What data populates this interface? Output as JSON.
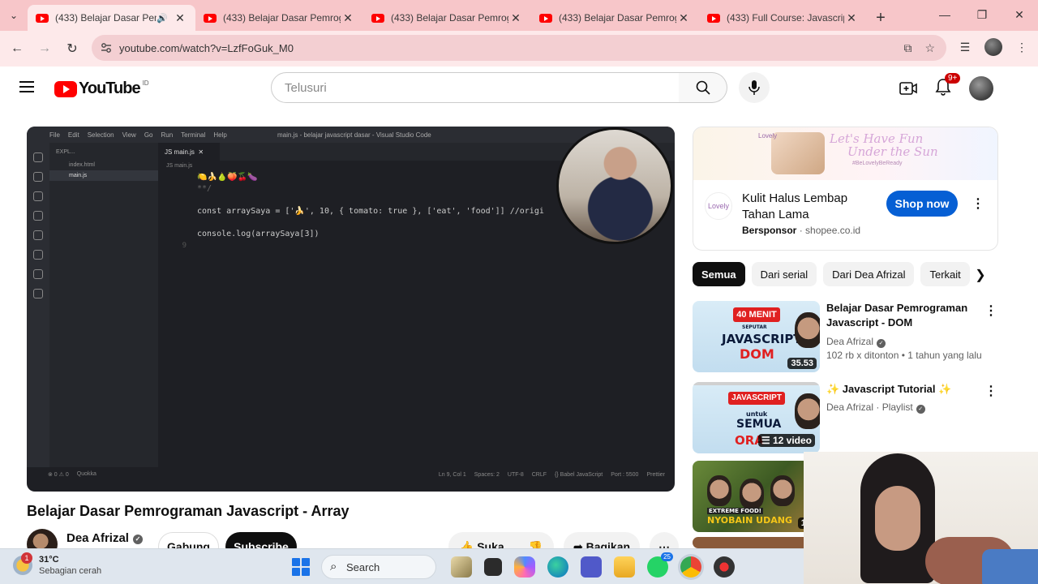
{
  "browser": {
    "tabs": [
      {
        "title": "(433) Belajar Dasar Pemrograman",
        "active": true,
        "audio": true
      },
      {
        "title": "(433) Belajar Dasar Pemrograman",
        "active": false
      },
      {
        "title": "(433) Belajar Dasar Pemrograman",
        "active": false
      },
      {
        "title": "(433) Belajar Dasar Pemrograman",
        "active": false
      },
      {
        "title": "(433) Full Course: Javascript",
        "active": false
      }
    ],
    "url": "youtube.com/watch?v=LzfFoGuk_M0"
  },
  "yt": {
    "logo_word": "YouTube",
    "country": "ID",
    "search_placeholder": "Telusuri",
    "notif_count": "9+"
  },
  "player": {
    "vscode_menu": [
      "File",
      "Edit",
      "Selection",
      "View",
      "Go",
      "Run",
      "Terminal",
      "Help"
    ],
    "window_title": "main.js - belajar javascript dasar - Visual Studio Code",
    "explorer_header": "EXPL...",
    "files": [
      "index.html",
      "main.js"
    ],
    "tab_label": "JS  main.js",
    "breadcrumb": "JS  main.js",
    "code_lines": [
      {
        "n": "",
        "text": "      🍋🍌🍐🍑🍒🍆"
      },
      {
        "n": "",
        "text": "**/"
      },
      {
        "n": "",
        "text": ""
      },
      {
        "n": "",
        "text": "const arraySaya = ['🍌', 10, { tomato: true }, ['eat', 'food']] //origi"
      },
      {
        "n": "",
        "text": ""
      },
      {
        "n": "",
        "text": "console.log(arraySaya[3])"
      },
      {
        "n": "9",
        "text": ""
      }
    ],
    "status_left": [
      "⊗ 0 ⚠ 0",
      "Quokka"
    ],
    "status_right": [
      "Ln 9, Col 1",
      "Spaces: 2",
      "UTF-8",
      "CRLF",
      "{} Babel JavaScript",
      "Port : 5500",
      "Prettier"
    ]
  },
  "video": {
    "title": "Belajar Dasar Pemrograman Javascript - Array",
    "channel": "Dea Afrizal",
    "join_label": "Gabung",
    "subscribe_label": "Subscribe",
    "like_label": "Suka",
    "share_label": "Bagikan"
  },
  "ad": {
    "brand": "Lovely",
    "slogan_line1": "Let's Have Fun",
    "slogan_line2": "Under the Sun",
    "hashtag": "#BeLovelyBeReady",
    "title": "Kulit Halus Lembap Tahan Lama",
    "sponsor_label": "Bersponsor",
    "domain": "shopee.co.id",
    "cta": "Shop now"
  },
  "chips": [
    "Semua",
    "Dari serial",
    "Dari Dea Afrizal",
    "Terkait"
  ],
  "recommendations": [
    {
      "title": "Belajar Dasar Pemrograman Javascript - DOM",
      "channel": "Dea Afrizal",
      "stats": "102 rb x ditonton",
      "age": "1 tahun yang lalu",
      "duration": "35.53",
      "thumb_badge": "40 MENIT",
      "thumb_small": "SEPUTAR",
      "thumb_big": "JAVASCRIPT",
      "thumb_sub": "DOM"
    },
    {
      "title": "✨ Javascript Tutorial ✨",
      "channel": "Dea Afrizal",
      "channel_suffix": "· Playlist",
      "duration": "12 video",
      "thumb_badge": "JAVASCRIPT",
      "thumb_small": "untuk",
      "thumb_big": "SEMUA",
      "thumb_sub": "ORA"
    },
    {
      "duration": "10.",
      "thumb_caption_1": "EXTREME FOOD!",
      "thumb_caption_2": "NYOBAIN UDANG"
    }
  ],
  "taskbar": {
    "temperature": "31°C",
    "weather": "Sebagian cerah",
    "weather_badge": "1",
    "search_label": "Search",
    "whatsapp_badge": "25"
  }
}
